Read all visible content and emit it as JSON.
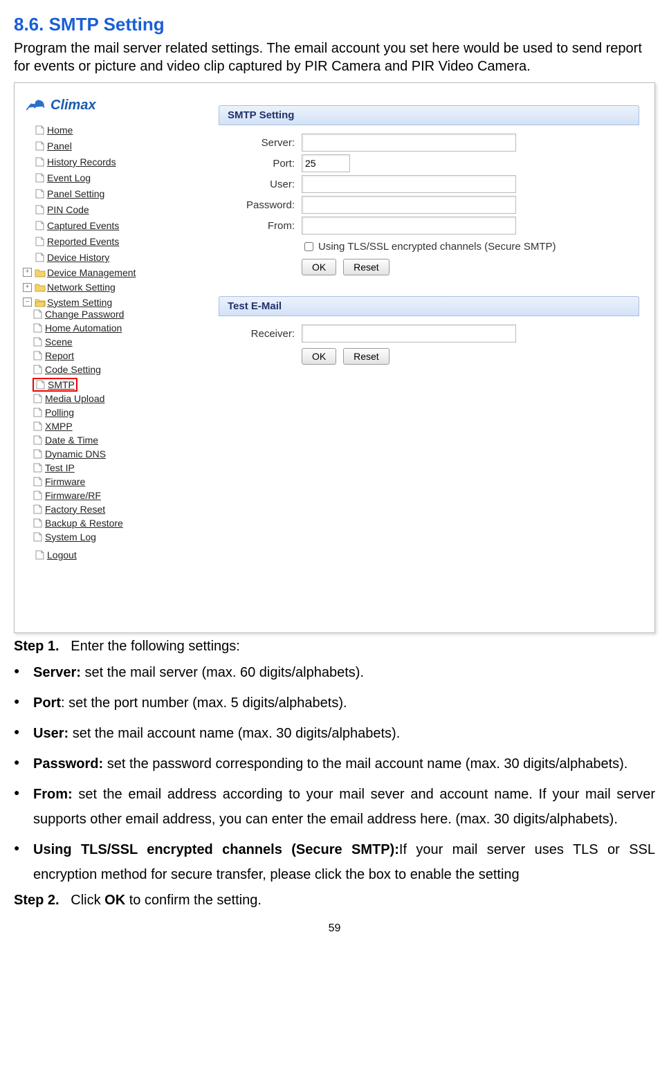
{
  "heading": "8.6. SMTP Setting",
  "intro": "Program the mail server related settings. The email account you set here would be used to send report for events or picture and video clip captured by PIR Camera and PIR Video Camera.",
  "logo_text": "Climax",
  "nav": {
    "home": "Home",
    "panel": "Panel",
    "history": "History Records",
    "eventlog": "Event Log",
    "panelsetting": "Panel Setting",
    "pin": "PIN Code",
    "captured": "Captured Events",
    "reported": "Reported Events",
    "devhistory": "Device History",
    "devmgmt": "Device Management",
    "network": "Network Setting",
    "system": "System Setting",
    "changepw": "Change Password",
    "homeauto": "Home Automation",
    "scene": "Scene",
    "report": "Report",
    "codeset": "Code Setting",
    "smtp": "SMTP",
    "media": "Media Upload",
    "polling": "Polling",
    "xmpp": "XMPP",
    "datetime": "Date & Time",
    "dns": "Dynamic DNS",
    "testip": "Test IP",
    "firmware": "Firmware",
    "firmwarerf": "Firmware/RF",
    "factory": "Factory Reset",
    "backup": "Backup & Restore",
    "syslog": "System Log",
    "logout": "Logout"
  },
  "smtp_panel": {
    "title": "SMTP Setting",
    "server_label": "Server:",
    "port_label": "Port:",
    "port_value": "25",
    "user_label": "User:",
    "password_label": "Password:",
    "from_label": "From:",
    "tls_label": "Using TLS/SSL encrypted channels (Secure SMTP)",
    "ok": "OK",
    "reset": "Reset"
  },
  "test_panel": {
    "title": "Test E-Mail",
    "receiver_label": "Receiver:",
    "ok": "OK",
    "reset": "Reset"
  },
  "step1_label": "Step 1.",
  "step1_text": "Enter the following settings:",
  "bullets": {
    "server_b": "Server:",
    "server_t": " set the mail server (max. 60 digits/alphabets).",
    "port_b": "Port",
    "port_t": ": set the port number (max. 5 digits/alphabets).",
    "user_b": "User:",
    "user_t": " set the mail account name (max. 30 digits/alphabets).",
    "password_b": "Password:",
    "password_t": " set the password corresponding to the mail account name (max. 30 digits/alphabets).",
    "from_b": "From:",
    "from_t": " set the email address according to your mail sever and account name. If your mail server supports other email address, you can enter the email address here. (max. 30 digits/alphabets).",
    "tls_b": "Using TLS/SSL encrypted channels (Secure SMTP):",
    "tls_t": "If your mail server uses TLS or SSL encryption method for secure transfer, please click the box to enable the setting"
  },
  "step2_label": "Step 2.",
  "step2_pre": "Click ",
  "step2_b": "OK",
  "step2_post": " to confirm the setting.",
  "pagenum": "59"
}
